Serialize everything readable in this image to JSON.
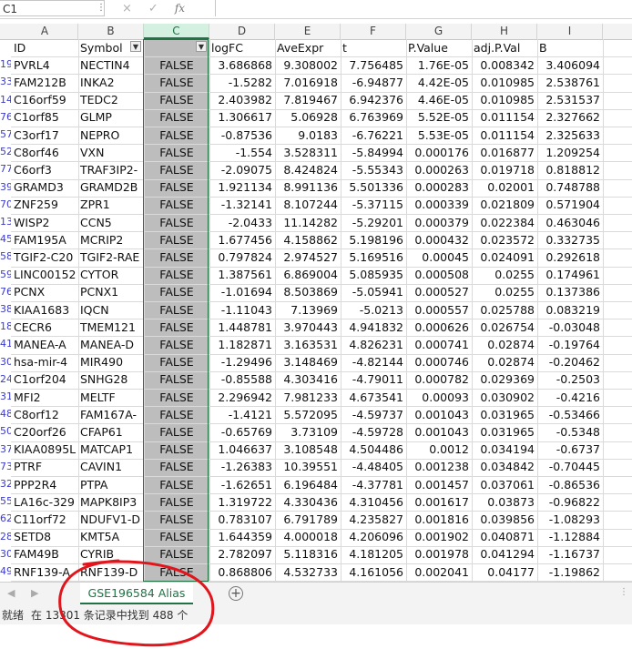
{
  "formula_bar": {
    "name_box": "C1",
    "cancel_icon": "×",
    "enter_icon": "✓",
    "fx_label": "fx"
  },
  "columns": [
    "A",
    "B",
    "C",
    "D",
    "E",
    "F",
    "G",
    "H",
    "I"
  ],
  "header_row": {
    "A": "ID",
    "B": "Symbol",
    "C": "",
    "D": "logFC",
    "E": "AveExpr",
    "F": "t",
    "G": "P.Value",
    "H": "adj.P.Val",
    "I": "B"
  },
  "rows": [
    {
      "rn": "19",
      "A": "PVRL4",
      "B": "NECTIN4",
      "C": "FALSE",
      "D": "3.686868",
      "E": "9.308002",
      "F": "7.756485",
      "G": "1.76E-05",
      "H": "0.008342",
      "I": "3.406094"
    },
    {
      "rn": "33",
      "A": "FAM212B",
      "B": "INKA2",
      "C": "FALSE",
      "D": "-1.5282",
      "E": "7.016918",
      "F": "-6.94877",
      "G": "4.42E-05",
      "H": "0.010985",
      "I": "2.538761"
    },
    {
      "rn": "14",
      "A": "C16orf59",
      "B": "TEDC2",
      "C": "FALSE",
      "D": "2.403982",
      "E": "7.819467",
      "F": "6.942376",
      "G": "4.46E-05",
      "H": "0.010985",
      "I": "2.531537"
    },
    {
      "rn": "76",
      "A": "C1orf85",
      "B": "GLMP",
      "C": "FALSE",
      "D": "1.306617",
      "E": "5.06928",
      "F": "6.763969",
      "G": "5.52E-05",
      "H": "0.011154",
      "I": "2.327662"
    },
    {
      "rn": "57",
      "A": "C3orf17",
      "B": "NEPRO",
      "C": "FALSE",
      "D": "-0.87536",
      "E": "9.0183",
      "F": "-6.76221",
      "G": "5.53E-05",
      "H": "0.011154",
      "I": "2.325633"
    },
    {
      "rn": "52",
      "A": "C8orf46",
      "B": "VXN",
      "C": "FALSE",
      "D": "-1.554",
      "E": "3.528311",
      "F": "-5.84994",
      "G": "0.000176",
      "H": "0.016877",
      "I": "1.209254"
    },
    {
      "rn": "77",
      "A": "C6orf3",
      "B": "TRAF3IP2-",
      "C": "FALSE",
      "D": "-2.09075",
      "E": "8.424824",
      "F": "-5.55343",
      "G": "0.000263",
      "H": "0.019718",
      "I": "0.818812"
    },
    {
      "rn": "39",
      "A": "GRAMD3",
      "B": "GRAMD2B",
      "C": "FALSE",
      "D": "1.921134",
      "E": "8.991136",
      "F": "5.501336",
      "G": "0.000283",
      "H": "0.02001",
      "I": "0.748788"
    },
    {
      "rn": "70",
      "A": "ZNF259",
      "B": "ZPR1",
      "C": "FALSE",
      "D": "-1.32141",
      "E": "8.107244",
      "F": "-5.37115",
      "G": "0.000339",
      "H": "0.021809",
      "I": "0.571904"
    },
    {
      "rn": "13",
      "A": "WISP2",
      "B": "CCN5",
      "C": "FALSE",
      "D": "-2.0433",
      "E": "11.14282",
      "F": "-5.29201",
      "G": "0.000379",
      "H": "0.022384",
      "I": "0.463046"
    },
    {
      "rn": "45",
      "A": "FAM195A",
      "B": "MCRIP2",
      "C": "FALSE",
      "D": "1.677456",
      "E": "4.158862",
      "F": "5.198196",
      "G": "0.000432",
      "H": "0.023572",
      "I": "0.332735"
    },
    {
      "rn": "58",
      "A": "TGIF2-C20",
      "B": "TGIF2-RAE",
      "C": "FALSE",
      "D": "0.797824",
      "E": "2.974527",
      "F": "5.169516",
      "G": "0.00045",
      "H": "0.024091",
      "I": "0.292618"
    },
    {
      "rn": "59",
      "A": "LINC00152",
      "B": "CYTOR",
      "C": "FALSE",
      "D": "1.387561",
      "E": "6.869004",
      "F": "5.085935",
      "G": "0.000508",
      "H": "0.0255",
      "I": "0.174961"
    },
    {
      "rn": "76",
      "A": "PCNX",
      "B": "PCNX1",
      "C": "FALSE",
      "D": "-1.01694",
      "E": "8.503869",
      "F": "-5.05941",
      "G": "0.000527",
      "H": "0.0255",
      "I": "0.137386"
    },
    {
      "rn": "38",
      "A": "KIAA1683",
      "B": "IQCN",
      "C": "FALSE",
      "D": "-1.11043",
      "E": "7.13969",
      "F": "-5.0213",
      "G": "0.000557",
      "H": "0.025788",
      "I": "0.083219"
    },
    {
      "rn": "18",
      "A": "CECR6",
      "B": "TMEM121",
      "C": "FALSE",
      "D": "1.448781",
      "E": "3.970443",
      "F": "4.941832",
      "G": "0.000626",
      "H": "0.026754",
      "I": "-0.03048"
    },
    {
      "rn": "41",
      "A": "MANEA-A",
      "B": "MANEA-D",
      "C": "FALSE",
      "D": "1.182871",
      "E": "3.163531",
      "F": "4.826231",
      "G": "0.000741",
      "H": "0.02874",
      "I": "-0.19764"
    },
    {
      "rn": "30",
      "A": "hsa-mir-4",
      "B": "MIR490",
      "C": "FALSE",
      "D": "-1.29496",
      "E": "3.148469",
      "F": "-4.82144",
      "G": "0.000746",
      "H": "0.02874",
      "I": "-0.20462"
    },
    {
      "rn": "24",
      "A": "C1orf204",
      "B": "SNHG28",
      "C": "FALSE",
      "D": "-0.85588",
      "E": "4.303416",
      "F": "-4.79011",
      "G": "0.000782",
      "H": "0.029369",
      "I": "-0.2503"
    },
    {
      "rn": "31",
      "A": "MFI2",
      "B": "MELTF",
      "C": "FALSE",
      "D": "2.296942",
      "E": "7.981233",
      "F": "4.673541",
      "G": "0.00093",
      "H": "0.030902",
      "I": "-0.4216"
    },
    {
      "rn": "48",
      "A": "C8orf12",
      "B": "FAM167A-",
      "C": "FALSE",
      "D": "-1.4121",
      "E": "5.572095",
      "F": "-4.59737",
      "G": "0.001043",
      "H": "0.031965",
      "I": "-0.53466"
    },
    {
      "rn": "50",
      "A": "C20orf26",
      "B": "CFAP61",
      "C": "FALSE",
      "D": "-0.65769",
      "E": "3.73109",
      "F": "-4.59728",
      "G": "0.001043",
      "H": "0.031965",
      "I": "-0.5348"
    },
    {
      "rn": "37",
      "A": "KIAA0895L",
      "B": "MATCAP1",
      "C": "FALSE",
      "D": "1.046637",
      "E": "3.108548",
      "F": "4.504486",
      "G": "0.0012",
      "H": "0.034194",
      "I": "-0.6737"
    },
    {
      "rn": "73",
      "A": "PTRF",
      "B": "CAVIN1",
      "C": "FALSE",
      "D": "-1.26383",
      "E": "10.39551",
      "F": "-4.48405",
      "G": "0.001238",
      "H": "0.034842",
      "I": "-0.70445"
    },
    {
      "rn": "32",
      "A": "PPP2R4",
      "B": "PTPA",
      "C": "FALSE",
      "D": "-1.62651",
      "E": "6.196484",
      "F": "-4.37781",
      "G": "0.001457",
      "H": "0.037061",
      "I": "-0.86536"
    },
    {
      "rn": "55",
      "A": "LA16c-329",
      "B": "MAPK8IP3",
      "C": "FALSE",
      "D": "1.319722",
      "E": "4.330436",
      "F": "4.310456",
      "G": "0.001617",
      "H": "0.03873",
      "I": "-0.96822"
    },
    {
      "rn": "62",
      "A": "C11orf72",
      "B": "NDUFV1-D",
      "C": "FALSE",
      "D": "0.783107",
      "E": "6.791789",
      "F": "4.235827",
      "G": "0.001816",
      "H": "0.039856",
      "I": "-1.08293"
    },
    {
      "rn": "28",
      "A": "SETD8",
      "B": "KMT5A",
      "C": "FALSE",
      "D": "1.644359",
      "E": "4.000018",
      "F": "4.206096",
      "G": "0.001902",
      "H": "0.040871",
      "I": "-1.12884"
    },
    {
      "rn": "30",
      "A": "FAM49B",
      "B": "CYRIB",
      "C": "FALSE",
      "D": "2.782097",
      "E": "5.118316",
      "F": "4.181205",
      "G": "0.001978",
      "H": "0.041294",
      "I": "-1.16737"
    },
    {
      "rn": "49",
      "A": "RNF139-A",
      "B": "RNF139-D",
      "C": "FALSE",
      "D": "0.868806",
      "E": "4.532733",
      "F": "4.161056",
      "G": "0.002041",
      "H": "0.04177",
      "I": "-1.19862"
    }
  ],
  "sheet_tabs": [
    {
      "label": "GSE196584 Alias",
      "active": true
    }
  ],
  "add_sheet_icon": "+",
  "status": {
    "mode": "就绪",
    "find_message": "在 13301 条记录中找到 488 个"
  },
  "colors": {
    "accent": "#217346",
    "selected_column": "#bdbdbd",
    "annotation": "#e0161c"
  }
}
